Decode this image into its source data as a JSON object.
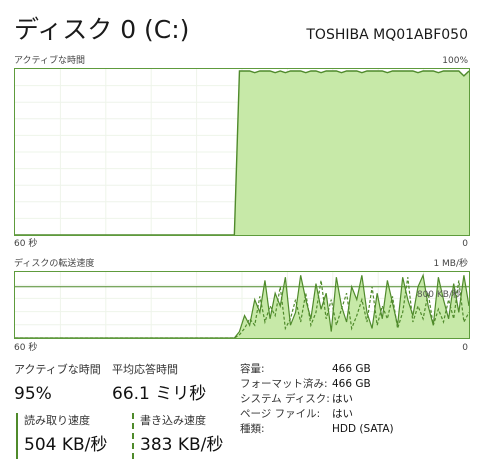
{
  "header": {
    "title": "ディスク 0 (C:)",
    "device_name": "TOSHIBA MQ01ABF050"
  },
  "active_chart": {
    "label": "アクティブな時間",
    "max_label": "100%",
    "time_label": "60 秒",
    "min_label": "0",
    "values_percent": [
      0,
      0,
      0,
      0,
      0,
      0,
      0,
      0,
      0,
      0,
      0,
      0,
      0,
      0,
      0,
      0,
      0,
      0,
      0,
      0,
      0,
      0,
      0,
      0,
      0,
      0,
      0,
      0,
      0,
      0,
      0,
      0,
      0,
      0,
      0,
      0,
      0,
      0,
      0,
      0,
      0,
      0,
      0,
      0,
      100,
      100,
      100,
      99,
      100,
      100,
      100,
      99,
      100,
      99,
      100,
      100,
      100,
      99,
      100,
      100,
      99,
      100,
      100,
      100,
      99,
      100,
      100,
      100,
      99,
      100,
      100,
      100,
      100,
      99,
      100,
      100,
      100,
      100,
      100,
      99,
      100,
      100,
      100,
      99,
      100,
      100,
      100,
      100,
      97,
      100
    ],
    "fill_color": "#c7e9a8",
    "line_color": "#4f8a2b"
  },
  "transfer_chart": {
    "label": "ディスクの転送速度",
    "max_label": "1 MB/秒",
    "time_label": "60 秒",
    "min_label": "0",
    "series_label": "800 KB/秒",
    "scale_max_kb": 1000,
    "reference_kb": 800,
    "read_kb": [
      0,
      0,
      0,
      0,
      0,
      0,
      0,
      0,
      0,
      0,
      0,
      0,
      0,
      0,
      0,
      0,
      0,
      0,
      0,
      0,
      0,
      0,
      0,
      0,
      0,
      0,
      0,
      0,
      0,
      0,
      0,
      0,
      0,
      0,
      0,
      0,
      0,
      0,
      0,
      0,
      0,
      0,
      0,
      0,
      100,
      350,
      200,
      600,
      400,
      900,
      300,
      700,
      500,
      950,
      200,
      400,
      980,
      600,
      300,
      850,
      450,
      700,
      100,
      950,
      500,
      250,
      800,
      600,
      980,
      400,
      150,
      700,
      300,
      900,
      550,
      200,
      950,
      600,
      350,
      800,
      980,
      500,
      200,
      950,
      600,
      300,
      850,
      400,
      980,
      500
    ],
    "write_kb": [
      0,
      0,
      0,
      0,
      0,
      0,
      0,
      0,
      0,
      0,
      0,
      0,
      0,
      0,
      0,
      0,
      0,
      0,
      0,
      0,
      0,
      0,
      0,
      0,
      0,
      0,
      0,
      0,
      0,
      0,
      0,
      0,
      0,
      0,
      0,
      0,
      0,
      0,
      0,
      0,
      0,
      0,
      0,
      0,
      50,
      150,
      300,
      200,
      650,
      250,
      500,
      350,
      800,
      150,
      300,
      600,
      250,
      700,
      200,
      400,
      900,
      300,
      600,
      200,
      450,
      700,
      150,
      350,
      600,
      250,
      800,
      200,
      500,
      300,
      650,
      150,
      400,
      950,
      250,
      500,
      300,
      700,
      200,
      450,
      250,
      600,
      300,
      900,
      250,
      400
    ],
    "fill_color": "#c7e9a8",
    "line_color": "#4f8a2b"
  },
  "stats": {
    "active_time": {
      "label": "アクティブな時間",
      "value": "95%"
    },
    "avg_response": {
      "label": "平均応答時間",
      "value": "66.1 ミリ秒"
    },
    "read_speed": {
      "label": "読み取り速度",
      "value": "504 KB/秒"
    },
    "write_speed": {
      "label": "書き込み速度",
      "value": "383 KB/秒"
    }
  },
  "properties": [
    {
      "label": "容量:",
      "value": "466 GB"
    },
    {
      "label": "フォーマット済み:",
      "value": "466 GB"
    },
    {
      "label": "システム ディスク:",
      "value": "はい"
    },
    {
      "label": "ページ ファイル:",
      "value": "はい"
    },
    {
      "label": "種類:",
      "value": "HDD (SATA)"
    }
  ]
}
